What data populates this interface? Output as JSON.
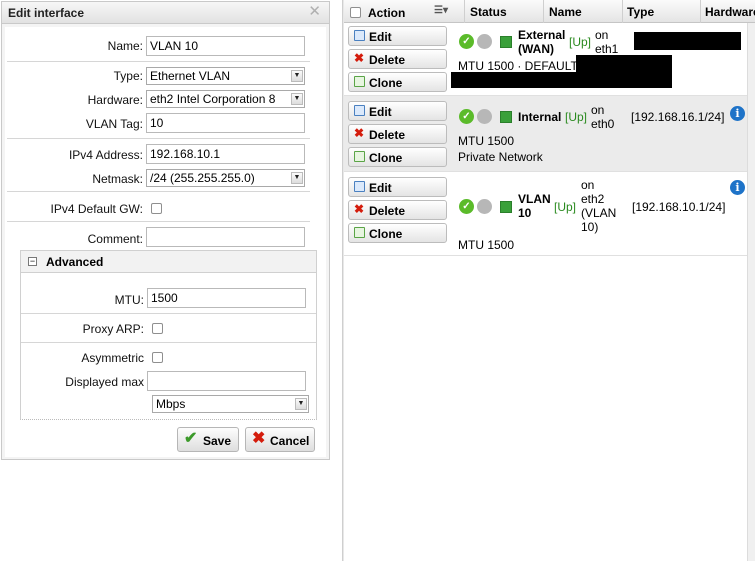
{
  "dialog": {
    "title": "Edit interface",
    "close_glyph": "✕",
    "fields": {
      "name": {
        "label": "Name:",
        "value": "VLAN 10"
      },
      "type": {
        "label": "Type:",
        "value": "Ethernet VLAN"
      },
      "hardware": {
        "label": "Hardware:",
        "value": "eth2 Intel Corporation 8"
      },
      "vlan_tag": {
        "label": "VLAN Tag:",
        "value": "10"
      },
      "ipv4_address": {
        "label": "IPv4 Address:",
        "value": "192.168.10.1"
      },
      "netmask": {
        "label": "Netmask:",
        "value": "/24 (255.255.255.0)"
      },
      "ipv4_default_gw": {
        "label": "IPv4 Default GW:",
        "checked": false
      },
      "comment": {
        "label": "Comment:",
        "value": ""
      }
    },
    "advanced": {
      "title": "Advanced",
      "toggle_glyph": "−",
      "mtu": {
        "label": "MTU:",
        "value": "1500"
      },
      "proxy_arp": {
        "label": "Proxy ARP:",
        "checked": false
      },
      "asymmetric": {
        "label": "Asymmetric",
        "checked": false
      },
      "displayed_max": {
        "label": "Displayed max",
        "value": ""
      },
      "unit": {
        "value": "Mbps"
      }
    },
    "buttons": {
      "save": {
        "label": "Save",
        "icon": "check-icon",
        "glyph": "✔",
        "color": "#3c9a2a"
      },
      "cancel": {
        "label": "Cancel",
        "icon": "x-icon",
        "glyph": "✖",
        "color": "#d41c0c"
      }
    }
  },
  "grid": {
    "columns": {
      "action": "Action",
      "status": "Status",
      "name": "Name",
      "type": "Type",
      "hardware": "Hardware"
    },
    "row_actions": {
      "edit": "Edit",
      "delete": "Delete",
      "clone": "Clone",
      "delete_glyph": "✖"
    },
    "rows": [
      {
        "name_line1": "External",
        "name_line2": "(WAN)",
        "status": "[Up]",
        "on_line1": "on",
        "on_line2": "eth1",
        "address": "",
        "mtu_line": "MTU 1500 · DEFAULT",
        "comment": ""
      },
      {
        "name_line1": "Internal",
        "name_line2": "",
        "status": "[Up]",
        "on_line1": "on",
        "on_line2": "eth0",
        "address": "[192.168.16.1/24]",
        "mtu_line": "MTU 1500",
        "comment": "Private Network",
        "info_glyph": "i"
      },
      {
        "name_line1": "VLAN",
        "name_line2": "10",
        "status": "[Up]",
        "on_line1": "on",
        "on_line2": "eth2",
        "on_line3": "(VLAN",
        "on_line4": "10)",
        "address": "[192.168.10.1/24]",
        "mtu_line": "MTU 1500",
        "comment": "",
        "info_glyph": "i"
      }
    ],
    "status_ok_glyph": "✓"
  },
  "colors": {
    "up_green": "#2a8a1f",
    "info_blue": "#1e73c8",
    "delete_red": "#d41c0c"
  }
}
